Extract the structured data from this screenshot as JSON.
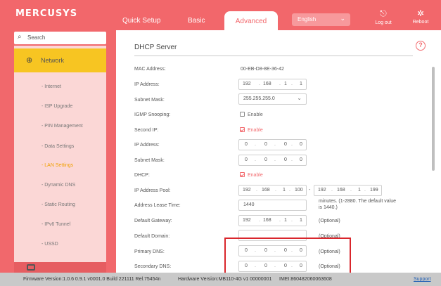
{
  "header": {
    "logo": "MERCUSYS",
    "tabs": [
      {
        "label": "Quick Setup"
      },
      {
        "label": "Basic"
      },
      {
        "label": "Advanced"
      }
    ],
    "language": "English",
    "logout_label": "Log out",
    "reboot_label": "Reboot",
    "accent_color": "#f2676b"
  },
  "sidebar": {
    "search_placeholder": "Search",
    "group_label": "Network",
    "items": [
      {
        "label": "- Internet"
      },
      {
        "label": "- ISP Upgrade"
      },
      {
        "label": "- PIN Management"
      },
      {
        "label": "- Data Settings"
      },
      {
        "label": "- LAN Settings"
      },
      {
        "label": "- Dynamic DNS"
      },
      {
        "label": "- Static Routing"
      },
      {
        "label": "- IPv6 Tunnel"
      },
      {
        "label": "- USSD"
      }
    ],
    "active_item": "- LAN Settings",
    "active_color": "#f0a000"
  },
  "dhcp": {
    "section_title": "DHCP Server",
    "help_icon": "?",
    "mac_label": "MAC Address:",
    "mac_value": "00-EB-D8-8E-36-42",
    "ip_label": "IP Address:",
    "ip": [
      "192",
      "168",
      "1",
      "1"
    ],
    "mask_label": "Subnet Mask:",
    "mask_value": "255.255.255.0",
    "igmp_label": "IGMP Snooping:",
    "igmp_text": "Enable",
    "second_ip_label": "Second IP:",
    "second_ip_text": "Enable",
    "ip2_label": "IP Address:",
    "ip2": [
      "0",
      "0",
      "0",
      "0"
    ],
    "mask2_label": "Subnet Mask:",
    "mask2": [
      "0",
      "0",
      "0",
      "0"
    ],
    "dhcp_label": "DHCP:",
    "dhcp_text": "Enable",
    "pool_label": "IP Address Pool:",
    "pool_start": [
      "192",
      "168",
      "1",
      "100"
    ],
    "pool_sep": "-",
    "pool_end": [
      "192",
      "168",
      "1",
      "199"
    ],
    "lease_label": "Address Lease Time:",
    "lease_value": "1440",
    "lease_hint_1": "minutes. (1-2880. The default value",
    "lease_hint_2": "is 1440.)",
    "gateway_label": "Default Gateway:",
    "gateway": [
      "192",
      "168",
      "1",
      "1"
    ],
    "domain_label": "Default Domain:",
    "primary_dns_label": "Primary DNS:",
    "primary_dns": [
      "0",
      "0",
      "0",
      "0"
    ],
    "secondary_dns_label": "Secondary DNS:",
    "secondary_dns": [
      "0",
      "0",
      "0",
      "0"
    ],
    "optional": "(Optional)"
  },
  "footer": {
    "firmware": "Firmware Version:1.0.6 0.9.1 v0001.0 Build 221111 Rel.75454n",
    "hardware": "Hardware Version:MB110-4G v1 00000001",
    "imei": "IMEI:860482060063608",
    "support": "Support"
  }
}
